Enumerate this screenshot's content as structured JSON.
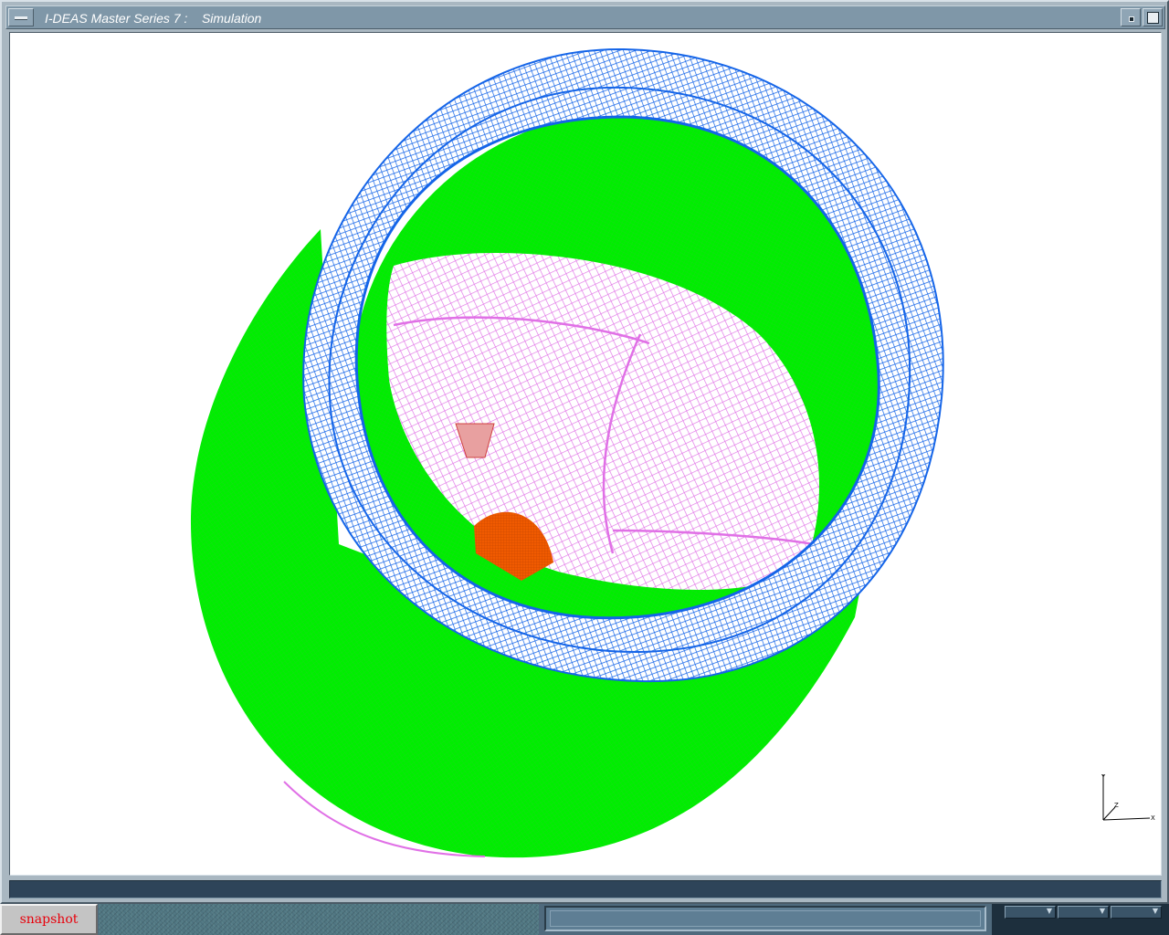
{
  "window": {
    "title": "I-DEAS Master Series 7 :    Simulation"
  },
  "viewport": {
    "background": "#ffffff",
    "model": {
      "outer_shell_color": "#00ee00",
      "rim_ring_color": "#1565e8",
      "inner_dome_color": "#e070e6",
      "hub_color": "#f05a00"
    },
    "triad": {
      "y_label": "Y",
      "z_label": "Z",
      "x_label": "X"
    }
  },
  "statusbar": {
    "text": ""
  },
  "taskbar": {
    "snapshot_label": "snapshot",
    "field_text": "",
    "tray_arrows": [
      "▼",
      "▼",
      "▼"
    ]
  }
}
